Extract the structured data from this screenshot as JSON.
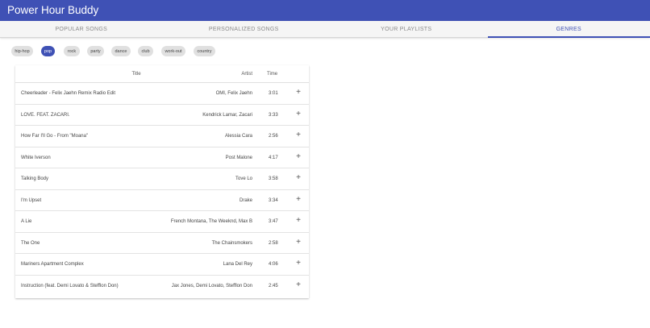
{
  "app": {
    "title": "Power Hour Buddy",
    "accent": "#3f51b5"
  },
  "tabs": [
    {
      "label": "POPULAR SONGS"
    },
    {
      "label": "PERSONALIZED SONGS"
    },
    {
      "label": "YOUR PLAYLISTS"
    },
    {
      "label": "GENRES",
      "selected": true
    }
  ],
  "genres": [
    {
      "label": "hip-hop"
    },
    {
      "label": "pop",
      "selected": true
    },
    {
      "label": "rock"
    },
    {
      "label": "party"
    },
    {
      "label": "dance"
    },
    {
      "label": "club"
    },
    {
      "label": "work-out"
    },
    {
      "label": "country"
    }
  ],
  "table": {
    "headers": {
      "title": "Title",
      "artist": "Artist",
      "time": "Time"
    },
    "add_icon": "plus-icon",
    "rows": [
      {
        "title": "Cheerleader - Felix Jaehn Remix Radio Edit",
        "artist": "OMI, Felix Jaehn",
        "time": "3:01"
      },
      {
        "title": "LOVE. FEAT. ZACARI.",
        "artist": "Kendrick Lamar, Zacari",
        "time": "3:33"
      },
      {
        "title": "How Far I'll Go - From \"Moana\"",
        "artist": "Alessia Cara",
        "time": "2:56"
      },
      {
        "title": "White Iverson",
        "artist": "Post Malone",
        "time": "4:17"
      },
      {
        "title": "Talking Body",
        "artist": "Tove Lo",
        "time": "3:58"
      },
      {
        "title": "I'm Upset",
        "artist": "Drake",
        "time": "3:34"
      },
      {
        "title": "A Lie",
        "artist": "French Montana, The Weeknd, Max B",
        "time": "3:47"
      },
      {
        "title": "The One",
        "artist": "The Chainsmokers",
        "time": "2:58"
      },
      {
        "title": "Mariners Apartment Complex",
        "artist": "Lana Del Rey",
        "time": "4:06"
      },
      {
        "title": "Instruction (feat. Demi Lovato & Stefflon Don)",
        "artist": "Jax Jones, Demi Lovato, Stefflon Don",
        "time": "2:45"
      }
    ]
  }
}
